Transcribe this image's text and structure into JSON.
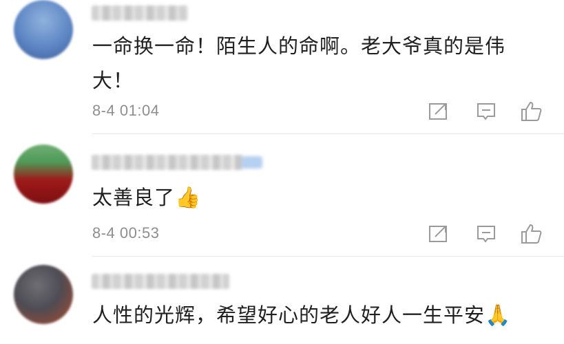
{
  "comments": [
    {
      "text": "一命换一命！陌生人的命啊。老大爷真的是伟大！",
      "emoji": "",
      "time": "8-4 01:04"
    },
    {
      "text": "太善良了",
      "emoji": "👍",
      "time": "8-4 00:53"
    },
    {
      "text": "人性的光辉，希望好心的老人好人一生平安",
      "emoji": "🙏",
      "time": ""
    }
  ],
  "icons": {
    "share": "share-icon",
    "reply": "comment-icon",
    "like": "thumbs-up-icon"
  },
  "colors": {
    "text": "#1f1f1f",
    "muted": "#8e8e8e",
    "icon": "#9a9a9a",
    "divider": "#e8e8e8"
  }
}
